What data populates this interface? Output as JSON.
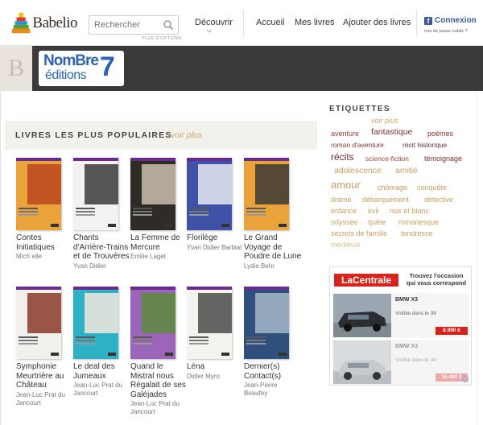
{
  "header": {
    "logo_text": "Babelio",
    "search_placeholder": "Rechercher",
    "plus_options": "PLUS D'OPTIONS",
    "nav": {
      "decouvrir": "Découvrir",
      "accueil": "Accueil",
      "mes_livres": "Mes livres",
      "ajouter": "Ajouter des livres"
    },
    "connexion": "Connexion",
    "mdp_oublie": "mot de passe oublié ?"
  },
  "publisher": {
    "line1": "NomBre",
    "line2": "éditions",
    "seven": "7",
    "initial": "B"
  },
  "popular": {
    "title": "LIVRES LES PLUS POPULAIRES",
    "voir_plus": "voir plus",
    "books": [
      {
        "title": "Contes Initiatiques",
        "author": "Mich`elle",
        "bg": "#e9a33a",
        "art": "#b8461f"
      },
      {
        "title": "Chants d'Arrière-Trains et de Trouvères",
        "author": "Yvan Didier",
        "bg": "#f2f2f2",
        "art": "#3a3a3a"
      },
      {
        "title": "La Femme de Mercure",
        "author": "Emilie Laget",
        "bg": "#2f2b27",
        "art": "#c9c0b0"
      },
      {
        "title": "Florilège",
        "author": "Yvan Didier Barbiat",
        "bg": "#3f52a8",
        "art": "#e6e9f2"
      },
      {
        "title": "Le Grand Voyage de Poudre de Lune",
        "author": "Lydie Behr",
        "bg": "#e9a33a",
        "art": "#3b3a36"
      },
      {
        "title": "Symphonie Meurtrière au Château",
        "author": "Jean-Luc Prat du Jancourt",
        "bg": "#f2f0ec",
        "art": "#8a3b2a"
      },
      {
        "title": "Le deal des Jumeaux",
        "author": "Jean-Luc Prat du Jancourt",
        "bg": "#2fb1c5",
        "art": "#f1e9dc"
      },
      {
        "title": "Quand le Mistral nous Régalait de ses Galéjades",
        "author": "Jean-Luc Prat du Jancourt",
        "bg": "#9b66b8",
        "art": "#5c8c3c"
      },
      {
        "title": "Léna",
        "author": "Didier Myro",
        "bg": "#f4f3f0",
        "art": "#4a4a4a"
      },
      {
        "title": "Dernier(s) Contact(s)",
        "author": "Jean-Pierre Beaufey",
        "bg": "#2f4f7c",
        "art": "#a5b7c9"
      }
    ]
  },
  "etiquettes": {
    "title": "ETIQUETTES",
    "voir_plus": "voir plus",
    "tags": [
      {
        "label": "aventure",
        "color": "#9c3b3b",
        "size": 9
      },
      {
        "label": "fantastique",
        "color": "#7b2f2f",
        "size": 10.5
      },
      {
        "label": "poèmes",
        "color": "#8a3030",
        "size": 9
      },
      {
        "label": "roman d'aventure",
        "color": "#8a3030",
        "size": 8.5
      },
      {
        "label": "récit historique",
        "color": "#6e2a2a",
        "size": 8.5
      },
      {
        "label": "récits",
        "color": "#6e2a2a",
        "size": 12
      },
      {
        "label": "science-fiction",
        "color": "#a04545",
        "size": 8.5
      },
      {
        "label": "témoignage",
        "color": "#7b2f2f",
        "size": 9
      },
      {
        "label": "adolescence",
        "color": "#c7a062",
        "size": 10.5
      },
      {
        "label": "amitié",
        "color": "#c7a062",
        "size": 10.5
      },
      {
        "label": "amour",
        "color": "#c7a062",
        "size": 13
      },
      {
        "label": "chômage",
        "color": "#c7a062",
        "size": 9
      },
      {
        "label": "conquête",
        "color": "#c7a062",
        "size": 9
      },
      {
        "label": "drame",
        "color": "#c7a062",
        "size": 9
      },
      {
        "label": "débarquement",
        "color": "#c7a062",
        "size": 9
      },
      {
        "label": "détective",
        "color": "#c7a062",
        "size": 9
      },
      {
        "label": "enfance",
        "color": "#c7a062",
        "size": 9
      },
      {
        "label": "exil",
        "color": "#c7a062",
        "size": 9
      },
      {
        "label": "noir et blanc",
        "color": "#c7a062",
        "size": 9
      },
      {
        "label": "odyssée",
        "color": "#c7a062",
        "size": 9
      },
      {
        "label": "quête",
        "color": "#c7a062",
        "size": 9
      },
      {
        "label": "romanesque",
        "color": "#c7a062",
        "size": 9
      },
      {
        "label": "secrets de famille",
        "color": "#c7a062",
        "size": 9
      },
      {
        "label": "tendresse",
        "color": "#c7a062",
        "size": 9
      },
      {
        "label": "médiéval",
        "color": "#d7bf8f",
        "size": 9
      }
    ]
  },
  "ad": {
    "brand": "LaCentrale",
    "tagline": "Trouvez l'occasion qui vous correspond",
    "cars": [
      {
        "name": "BMW X3",
        "visible": "Visible dans le 38",
        "price": "8.990 €"
      },
      {
        "name": "BMW X3",
        "visible": "Visible dans le 34",
        "price": "16.490 €"
      }
    ]
  }
}
